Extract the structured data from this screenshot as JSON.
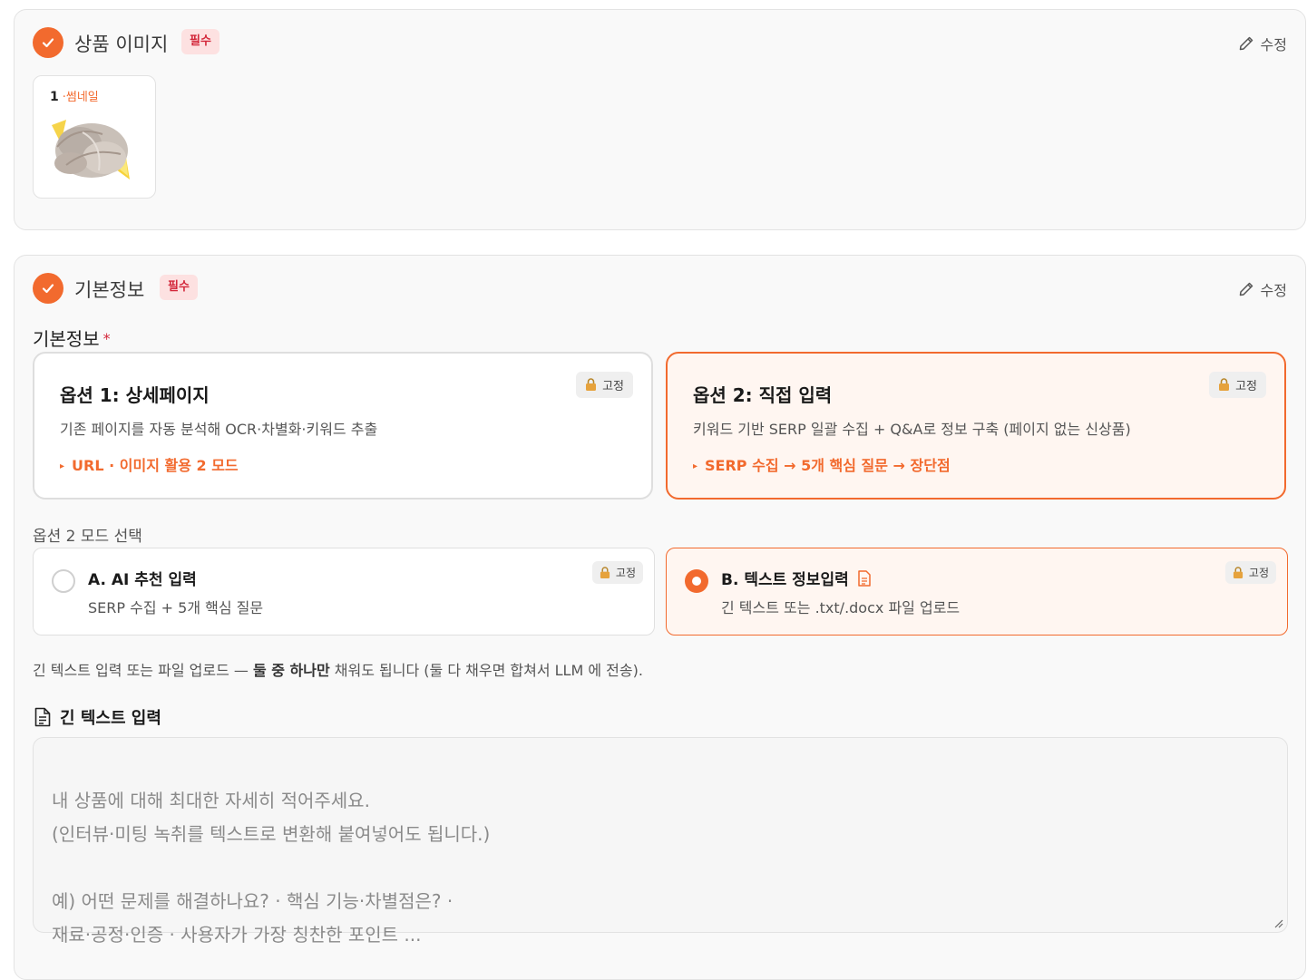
{
  "image_section": {
    "title": "상품 이미지",
    "required_badge": "필수",
    "edit_label": "수정",
    "images": [
      {
        "index": "1",
        "tag": "·썸네일",
        "subject": "raw shrimp with lemon"
      }
    ]
  },
  "basic_section": {
    "title": "기본정보",
    "required_badge": "필수",
    "edit_label": "수정",
    "field_label": "기본정보",
    "required_mark": "*",
    "options": [
      {
        "title": "옵션 1: 상세페이지",
        "description": "기존 페이지를 자동 분석해 OCR·차별화·키워드 추출",
        "tip": "URL · 이미지 활용 2 모드",
        "lock_label": "고정",
        "selected": false
      },
      {
        "title": "옵션 2: 직접 입력",
        "description": "키워드 기반 SERP 일괄 수집 + Q&A로 정보 구축 (페이지 없는 신상품)",
        "tip": "SERP 수집 → 5개 핵심 질문 → 장단점",
        "lock_label": "고정",
        "selected": true
      }
    ],
    "mode_label": "옵션 2 모드 선택",
    "modes": [
      {
        "title": "A. AI 추천 입력",
        "description": "SERP 수집 + 5개 핵심 질문",
        "lock_label": "고정",
        "selected": false
      },
      {
        "title": "B. 텍스트 정보입력",
        "description": "긴 텍스트 또는 .txt/.docx 파일 업로드",
        "lock_label": "고정",
        "selected": true
      }
    ],
    "hint": {
      "before": "긴 텍스트 입력 또는 파일 업로드 — ",
      "bold": "둘 중 하나만",
      "after": " 채워도 됩니다 (둘 다 채우면 합쳐서 LLM 에 전송)."
    },
    "long_text": {
      "label": "긴 텍스트 입력",
      "placeholder": "내 상품에 대해 최대한 자세히 적어주세요.\n(인터뷰·미팅 녹취를 텍스트로 변환해 붙여넣어도 됩니다.)\n\n예) 어떤 문제를 해결하나요? · 핵심 기능·차별점은? ·\n    재료·공정·인증 · 사용자가 가장 칭찬한 포인트 ..."
    }
  },
  "colors": {
    "accent": "#f26a2e",
    "required_bg": "#fde1e1",
    "required_text": "#d3273a",
    "selected_bg": "#fff6f1"
  },
  "icons": [
    "check-icon",
    "pencil-icon",
    "lock-icon",
    "document-icon",
    "resize-grip-icon"
  ]
}
